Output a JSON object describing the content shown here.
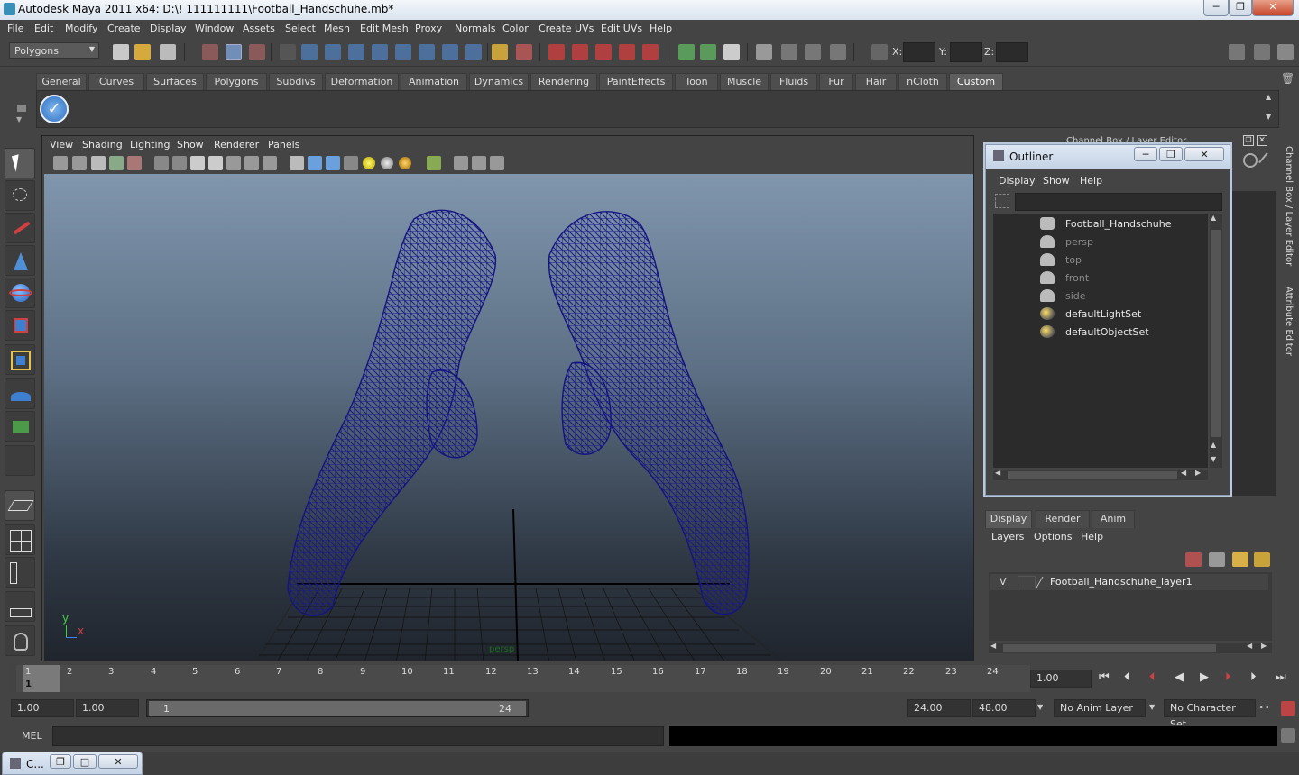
{
  "window": {
    "title": "Autodesk Maya 2011 x64: D:\\! 111111111\\Football_Handschuhe.mb*",
    "minimize": "─",
    "maximize": "❐",
    "close": "✕"
  },
  "menubar": [
    "File",
    "Edit",
    "Modify",
    "Create",
    "Display",
    "Window",
    "Assets",
    "Select",
    "Mesh",
    "Edit Mesh",
    "Proxy",
    "Normals",
    "Color",
    "Create UVs",
    "Edit UVs",
    "Help"
  ],
  "status_line": {
    "mode_menu": "Polygons",
    "x_label": "X:",
    "y_label": "Y:",
    "z_label": "Z:"
  },
  "shelf_tabs": [
    "General",
    "Curves",
    "Surfaces",
    "Polygons",
    "Subdivs",
    "Deformation",
    "Animation",
    "Dynamics",
    "Rendering",
    "PaintEffects",
    "Toon",
    "Muscle",
    "Fluids",
    "Fur",
    "Hair",
    "nCloth",
    "Custom"
  ],
  "active_shelf_tab": "Custom",
  "viewport": {
    "menu": [
      "View",
      "Shading",
      "Lighting",
      "Show",
      "Renderer",
      "Panels"
    ],
    "camera_label": "persp",
    "axis_y": "y",
    "axis_x": "x"
  },
  "channel_box_title": "Channel Box / Layer Editor",
  "outliner": {
    "title": "Outliner",
    "menu": [
      "Display",
      "Show",
      "Help"
    ],
    "items": [
      {
        "label": "Football_Handschuhe",
        "dim": false,
        "icon": "mesh-icon"
      },
      {
        "label": "persp",
        "dim": true,
        "icon": "camera-icon"
      },
      {
        "label": "top",
        "dim": true,
        "icon": "camera-icon"
      },
      {
        "label": "front",
        "dim": true,
        "icon": "camera-icon"
      },
      {
        "label": "side",
        "dim": true,
        "icon": "camera-icon"
      },
      {
        "label": "defaultLightSet",
        "dim": false,
        "icon": "set-icon"
      },
      {
        "label": "defaultObjectSet",
        "dim": false,
        "icon": "set-icon"
      }
    ]
  },
  "layer_editor": {
    "tabs": [
      "Display",
      "Render",
      "Anim"
    ],
    "active_tab": "Display",
    "menu": [
      "Layers",
      "Options",
      "Help"
    ],
    "layer": {
      "visible": "V",
      "name": "Football_Handschuhe_layer1"
    }
  },
  "right_tabs": [
    "Channel Box / Layer Editor",
    "Attribute Editor"
  ],
  "time_slider": {
    "ticks": [
      "1",
      "2",
      "3",
      "4",
      "5",
      "6",
      "7",
      "8",
      "9",
      "10",
      "11",
      "12",
      "13",
      "14",
      "15",
      "16",
      "17",
      "18",
      "19",
      "20",
      "21",
      "22",
      "23",
      "24"
    ],
    "current_frame": "1",
    "current_time_field": "1.00"
  },
  "range_slider": {
    "start_time": "1.00",
    "playback_start": "1.00",
    "range_start_label": "1",
    "range_end_label": "24",
    "playback_end": "24.00",
    "end_time": "48.00",
    "anim_layer": "No Anim Layer",
    "character_set": "No Character Set"
  },
  "command_line": {
    "label": "MEL"
  },
  "taskbar": {
    "item": "C..."
  }
}
